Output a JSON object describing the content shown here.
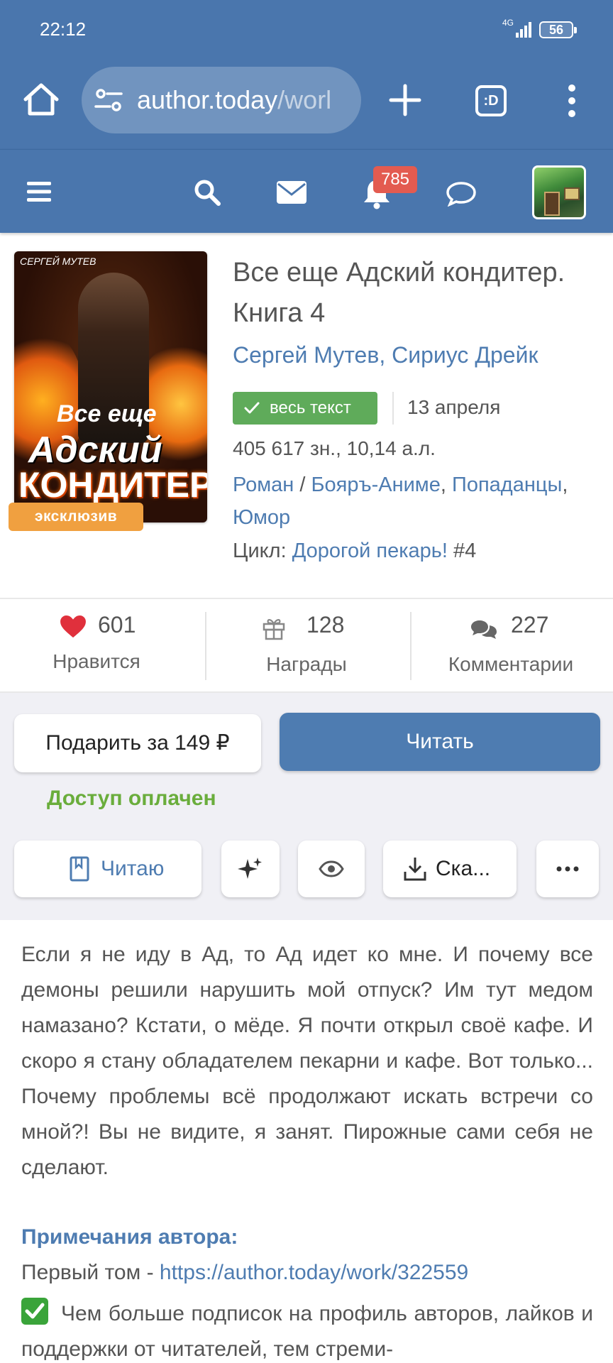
{
  "status_bar": {
    "time": "22:12",
    "network": "4G",
    "battery": "56"
  },
  "browser": {
    "url_host": "author.today",
    "url_path": "/worl",
    "tabs_label": ":D"
  },
  "site_header": {
    "notifications_count": "785"
  },
  "book": {
    "cover_authors_art": "СЕРГЕЙ МУТЕВ",
    "cover_title_1": "Все еще",
    "cover_title_2": "Адский",
    "cover_title_3": "КОНДИТЕР",
    "exclusive_badge": "эксклюзив",
    "title": "Все еще Адский кондитер. Книга 4",
    "author_1": "Сергей Мутев",
    "author_sep": ", ",
    "author_2": "Сириус Дрейк",
    "status_badge": "весь текст",
    "date": "13 апреля",
    "size": "405 617 зн., 10,14 а.л.",
    "genre_1": "Роман",
    "genre_sep_1": " / ",
    "genre_2": "Бояръ-Аниме",
    "genre_sep_2": ", ",
    "genre_3": "Попаданцы",
    "genre_sep_3": ", ",
    "genre_4": "Юмор",
    "cycle_label": "Цикл: ",
    "cycle_name": "Дорогой пекарь!",
    "cycle_num": " #4"
  },
  "stats": {
    "likes_count": "601",
    "likes_label": "Нравится",
    "awards_count": "128",
    "awards_label": "Награды",
    "comments_count": "227",
    "comments_label": "Комментарии"
  },
  "actions": {
    "gift_label": "Подарить за 149 ₽",
    "read_label": "Читать",
    "paid_label": "Доступ оплачен",
    "reading_label": "Читаю",
    "download_label": "Ска..."
  },
  "annotation": "Если я не иду в Ад, то Ад идет ко мне. И почему все демоны решили нарушить мой отпуск? Им тут медом намазано? Кстати, о мёде. Я почти открыл своё кафе. И скоро я стану обладателем пекарни и кафе. Вот только... Почему проблемы всё продолжают искать встречи со мной?! Вы не видите, я занят. Пирожные сами себя не сделают.",
  "notes": {
    "heading": "Примечания автора:",
    "first_vol_label": "Первый том - ",
    "first_vol_link": "https://author.today/work/322559",
    "promo_text": "Чем больше подписок на профиль авторов, лайков и поддержки от читателей, тем стреми-"
  },
  "colors": {
    "header_bg": "#4a76ad",
    "link": "#4e7cb1",
    "green_badge": "#5fab5a",
    "paid_green": "#6aad3c",
    "badge_red": "#e35b50",
    "exclusive_orange": "#f0a040"
  },
  "icons": [
    "home-icon",
    "tune-icon",
    "plus-icon",
    "tabs-icon",
    "menu-dots-icon",
    "hamburger-icon",
    "search-icon",
    "mail-icon",
    "bell-icon",
    "chat-icon",
    "heart-icon",
    "gift-icon",
    "comments-icon",
    "bookmark-icon",
    "sparkle-icon",
    "eye-icon",
    "download-icon",
    "more-icon",
    "check-icon"
  ]
}
